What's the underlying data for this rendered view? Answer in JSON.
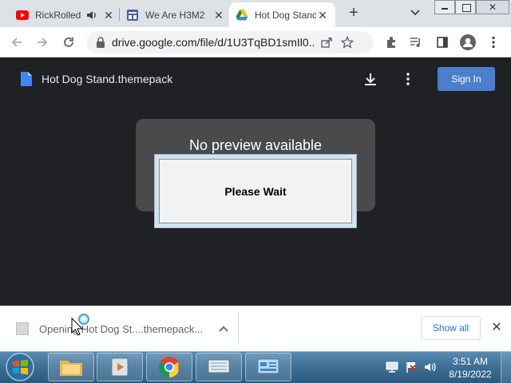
{
  "browser": {
    "tabs": [
      {
        "title": "RickRolled",
        "icon": "youtube-icon",
        "muted": true
      },
      {
        "title": "We Are H3M2",
        "icon": "site-icon"
      },
      {
        "title": "Hot Dog Stand",
        "icon": "google-drive-icon",
        "active": true
      }
    ],
    "new_tab_label": "+",
    "url": "drive.google.com/file/d/1U3TqBD1smIl0..."
  },
  "drive": {
    "file_name": "Hot Dog Stand.themepack",
    "sign_in_label": "Sign In",
    "no_preview_text": "No preview available"
  },
  "dialog": {
    "message": "Please Wait"
  },
  "downloads": {
    "item_text": "Opening Hot Dog St....themepack...",
    "show_all_label": "Show all"
  },
  "taskbar": {
    "time": "3:51 AM",
    "date": "8/19/2022"
  },
  "colors": {
    "page_background": "#202124",
    "sign_in_button": "#4a7ecf",
    "link_blue": "#1a73e8"
  }
}
